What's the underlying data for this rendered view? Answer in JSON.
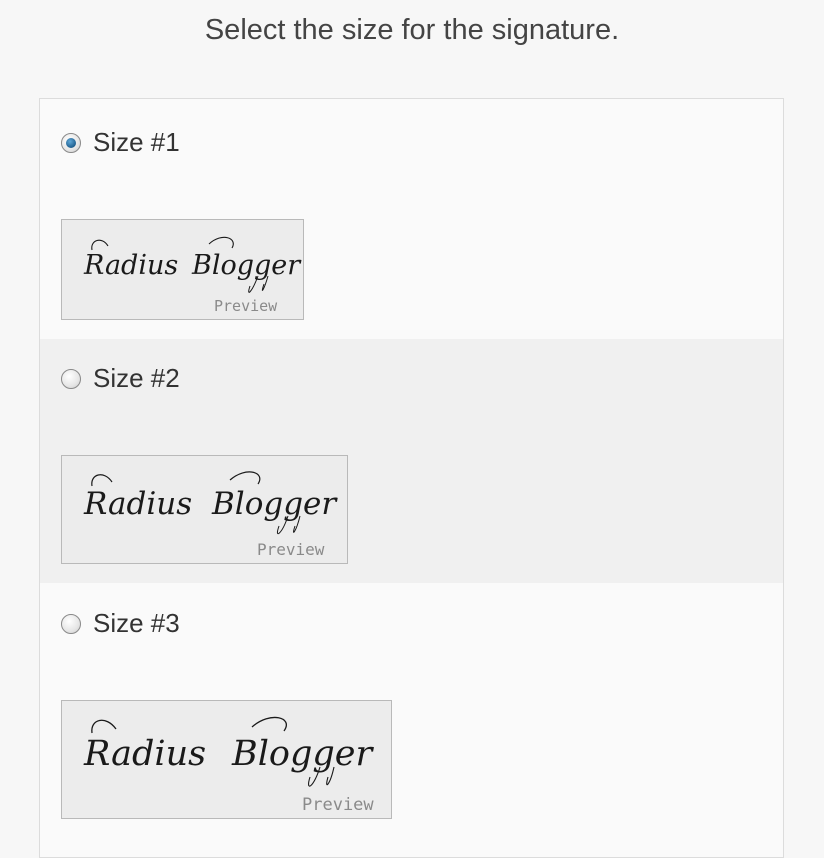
{
  "page": {
    "title": "Select the size for the signature."
  },
  "options": [
    {
      "label": "Size #1",
      "checked": true,
      "preview_label": "Preview",
      "signature": [
        "Radius",
        "Blogger"
      ]
    },
    {
      "label": "Size #2",
      "checked": false,
      "preview_label": "Preview",
      "signature": [
        "Radius",
        "Blogger"
      ]
    },
    {
      "label": "Size #3",
      "checked": false,
      "preview_label": "Preview",
      "signature": [
        "Radius",
        "Blogger"
      ]
    }
  ],
  "colors": {
    "radio_selected": "#1f5f8f",
    "preview_bg": "#ececec",
    "signature_ink": "#1a1a1a"
  }
}
